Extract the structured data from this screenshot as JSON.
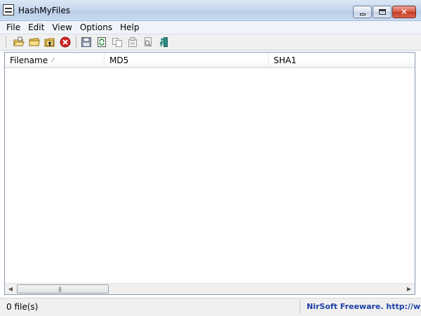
{
  "window": {
    "title": "HashMyFiles",
    "icon": "app-icon"
  },
  "menu": {
    "items": [
      "File",
      "Edit",
      "View",
      "Options",
      "Help"
    ]
  },
  "toolbar": {
    "icons": [
      "open-files-icon",
      "open-folder-icon",
      "add-folder-icon",
      "delete-icon",
      "save-icon",
      "refresh-icon",
      "copy-icon",
      "properties-icon",
      "find-icon",
      "exit-icon"
    ]
  },
  "columns": [
    {
      "label": "Filename",
      "sorted": "ascending"
    },
    {
      "label": "MD5"
    },
    {
      "label": "SHA1"
    }
  ],
  "status": {
    "file_count": "0 file(s)",
    "credit": "NirSoft Freeware.  http://www.nirsoft.net"
  },
  "colors": {
    "credit_text": "#1d3fa7",
    "delete_red": "#d42222"
  }
}
